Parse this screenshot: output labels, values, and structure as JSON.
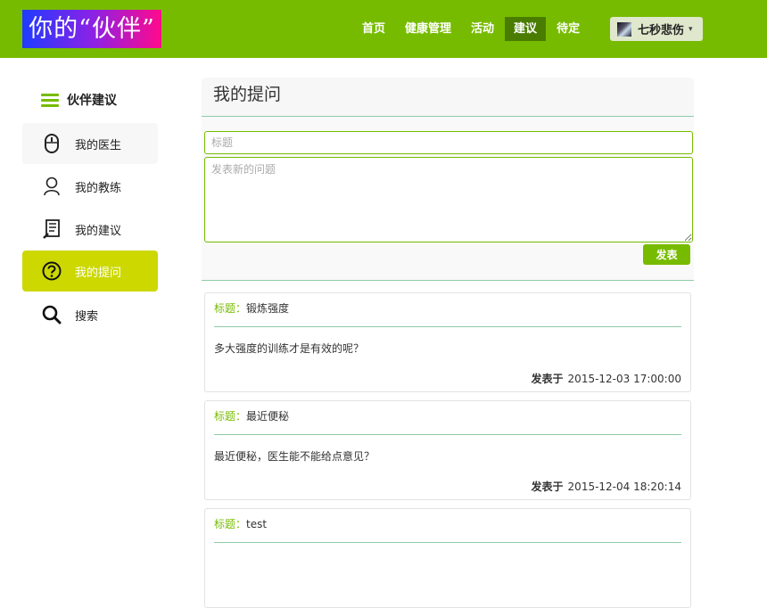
{
  "brand": {
    "logo_text": "你的“伙伴”"
  },
  "nav": {
    "items": [
      "首页",
      "健康管理",
      "活动",
      "建议",
      "待定"
    ],
    "active": "建议"
  },
  "user": {
    "name": "七秒悲伤",
    "caret": "▾"
  },
  "sidebar": {
    "title": "伙伴建议",
    "items": [
      {
        "label": "我的医生",
        "icon": "mouse-icon"
      },
      {
        "label": "我的教练",
        "icon": "person-icon"
      },
      {
        "label": "我的建议",
        "icon": "document-icon"
      },
      {
        "label": "我的提问",
        "icon": "question-icon"
      },
      {
        "label": "搜索",
        "icon": "search-icon"
      }
    ],
    "active": "我的提问"
  },
  "main": {
    "title": "我的提问",
    "form": {
      "title_placeholder": "标题",
      "body_placeholder": "发表新的问题",
      "submit_label": "发表"
    },
    "posts": [
      {
        "title_label": "标题",
        "sep": "：",
        "title": "锻炼强度",
        "body": "多大强度的训练才是有效的呢？",
        "meta_label": "发表于",
        "time": "2015-12-03 17:00:00"
      },
      {
        "title_label": "标题",
        "sep": "：",
        "title": "最近便秘",
        "body": "最近便秘，医生能不能给点意见？",
        "meta_label": "发表于",
        "time": "2015-12-04 18:20:14"
      },
      {
        "title_label": "标题",
        "sep": "：",
        "title": "test",
        "body": "",
        "meta_label": "",
        "time": ""
      }
    ]
  },
  "colors": {
    "brand_green": "#77bb00",
    "nav_active": "#4a7c00",
    "sidebar_active": "#ccd800",
    "divider": "#8fcca8"
  }
}
